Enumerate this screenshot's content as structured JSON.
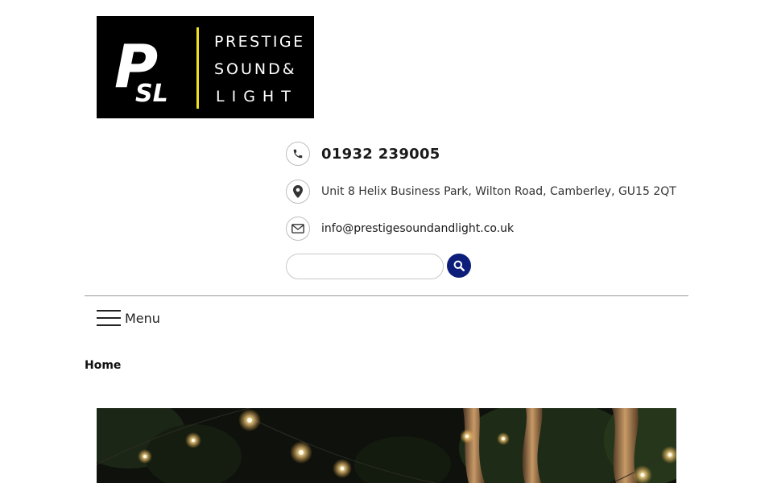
{
  "brand": {
    "monogram_top": "P",
    "monogram_bottom": "SL",
    "name_lines": [
      "PRESTIGE",
      "SOUND&",
      "LIGHT"
    ],
    "colors": {
      "background": "#000000",
      "text": "#ffffff",
      "divider": "#f0e020"
    }
  },
  "contact": {
    "phone": "01932 239005",
    "address": "Unit 8 Helix Business Park, Wilton Road, Camberley, GU15 2QT",
    "email": "info@prestigesoundandlight.co.uk",
    "icons": [
      "phone-icon",
      "map-pin-icon",
      "envelope-icon"
    ]
  },
  "search": {
    "value": "",
    "icon": "search-icon",
    "button_color": "#0c1e7a"
  },
  "nav": {
    "menu_label": "Menu",
    "icon": "hamburger-icon"
  },
  "breadcrumb": {
    "current": "Home"
  },
  "hero": {
    "description_icon": "festoon-lights-garden-photo"
  }
}
